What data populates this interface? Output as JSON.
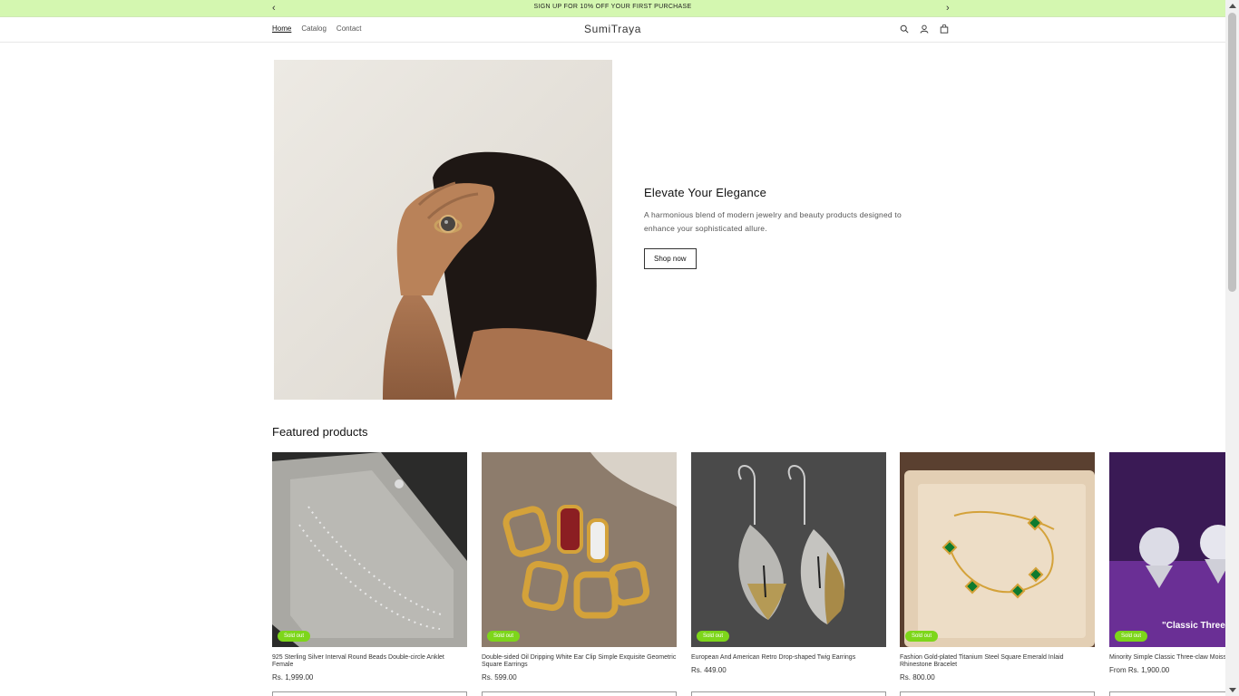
{
  "announcement": {
    "text": "SIGN UP FOR 10% OFF YOUR FIRST PURCHASE",
    "prev_icon": "chevron-left-icon",
    "next_icon": "chevron-right-icon"
  },
  "header": {
    "nav": [
      {
        "label": "Home",
        "active": true
      },
      {
        "label": "Catalog",
        "active": false
      },
      {
        "label": "Contact",
        "active": false
      }
    ],
    "logo": "SumiTraya",
    "icons": [
      "search-icon",
      "account-icon",
      "cart-icon"
    ]
  },
  "hero": {
    "title": "Elevate Your Elegance",
    "description": "A harmonious blend of modern jewelry and beauty products designed to enhance your sophisticated allure.",
    "button_label": "Shop now"
  },
  "featured": {
    "title": "Featured products",
    "products": [
      {
        "title": "925 Sterling Silver Interval Round Beads Double-circle Anklet Female",
        "price": "Rs. 1,999.00",
        "badge": "Sold out"
      },
      {
        "title": "Double-sided Oil Dripping White Ear Clip Simple Exquisite Geometric Square Earrings",
        "price": "Rs. 599.00",
        "badge": "Sold out"
      },
      {
        "title": "European And American Retro Drop-shaped Twig Earrings",
        "price": "Rs. 449.00",
        "badge": "Sold out"
      },
      {
        "title": "Fashion Gold-plated Titanium Steel Square Emerald Inlaid Rhinestone Bracelet",
        "price": "Rs. 800.00",
        "badge": "Sold out"
      },
      {
        "title": "Minority Simple Classic Three-claw Moissanite",
        "price": "From Rs. 1,900.00",
        "badge": "Sold out",
        "image_text": "\"Classic Three-"
      }
    ]
  },
  "colors": {
    "announcement_bg": "#d4f7b0",
    "badge": "#7dd61a"
  }
}
